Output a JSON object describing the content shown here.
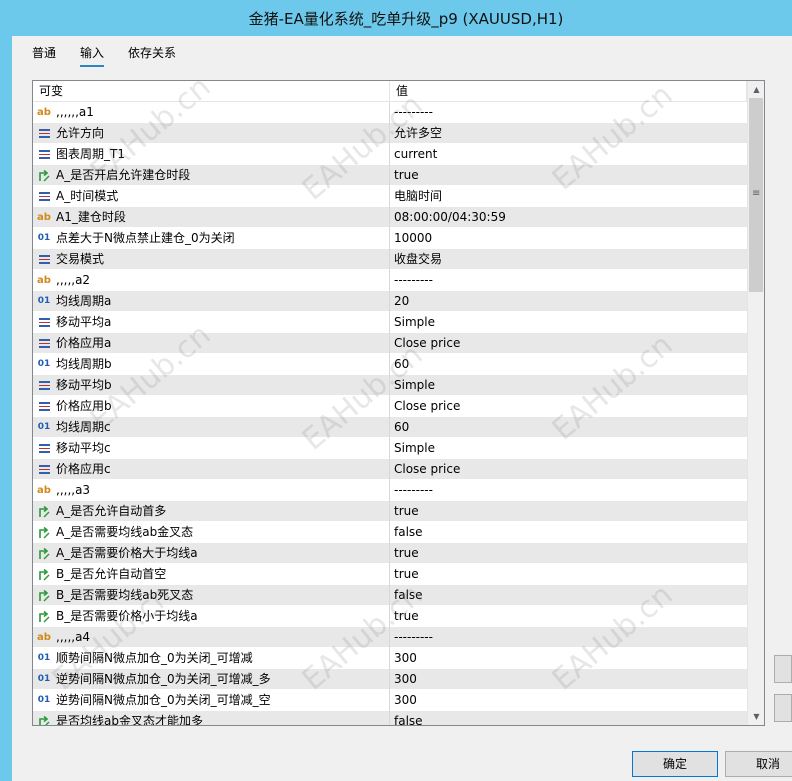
{
  "window": {
    "title": "金猪-EA量化系统_吃单升级_p9   (XAUUSD,H1)"
  },
  "tabs": [
    {
      "label": "普通",
      "active": false
    },
    {
      "label": "输入",
      "active": true
    },
    {
      "label": "依存关系",
      "active": false
    }
  ],
  "grid": {
    "headers": {
      "variable": "可变",
      "value": "值"
    },
    "rows": [
      {
        "icon": "ab",
        "name": ",,,,,,a1",
        "value": "---------"
      },
      {
        "icon": "list",
        "name": "允许方向",
        "value": "允许多空"
      },
      {
        "icon": "list",
        "name": "图表周期_T1",
        "value": "current"
      },
      {
        "icon": "bool",
        "name": "A_是否开启允许建仓时段",
        "value": "true"
      },
      {
        "icon": "list",
        "name": "A_时间模式",
        "value": "电脑时间"
      },
      {
        "icon": "ab",
        "name": "A1_建仓时段",
        "value": "08:00:00/04:30:59"
      },
      {
        "icon": "num",
        "name": "点差大于N微点禁止建仓_0为关闭",
        "value": "10000"
      },
      {
        "icon": "list",
        "name": "交易模式",
        "value": "收盘交易"
      },
      {
        "icon": "ab",
        "name": ",,,,,a2",
        "value": "---------"
      },
      {
        "icon": "num",
        "name": "均线周期a",
        "value": "20"
      },
      {
        "icon": "list",
        "name": "移动平均a",
        "value": "Simple"
      },
      {
        "icon": "list",
        "name": "价格应用a",
        "value": "Close price"
      },
      {
        "icon": "num",
        "name": "均线周期b",
        "value": "60"
      },
      {
        "icon": "list",
        "name": "移动平均b",
        "value": "Simple"
      },
      {
        "icon": "list",
        "name": "价格应用b",
        "value": "Close price"
      },
      {
        "icon": "num",
        "name": "均线周期c",
        "value": "60"
      },
      {
        "icon": "list",
        "name": "移动平均c",
        "value": "Simple"
      },
      {
        "icon": "list",
        "name": "价格应用c",
        "value": "Close price"
      },
      {
        "icon": "ab",
        "name": ",,,,,a3",
        "value": "---------"
      },
      {
        "icon": "bool",
        "name": "A_是否允许自动首多",
        "value": "true"
      },
      {
        "icon": "bool",
        "name": "A_是否需要均线ab金叉态",
        "value": "false"
      },
      {
        "icon": "bool",
        "name": "A_是否需要价格大于均线a",
        "value": "true"
      },
      {
        "icon": "bool",
        "name": "B_是否允许自动首空",
        "value": "true"
      },
      {
        "icon": "bool",
        "name": "B_是否需要均线ab死叉态",
        "value": "false"
      },
      {
        "icon": "bool",
        "name": "B_是否需要价格小于均线a",
        "value": "true"
      },
      {
        "icon": "ab",
        "name": ",,,,,a4",
        "value": "---------"
      },
      {
        "icon": "num",
        "name": "顺势间隔N微点加仓_0为关闭_可增减",
        "value": "300"
      },
      {
        "icon": "num",
        "name": "逆势间隔N微点加仓_0为关闭_可增减_多",
        "value": "300"
      },
      {
        "icon": "num",
        "name": "逆势间隔N微点加仓_0为关闭_可增减_空",
        "value": "300"
      },
      {
        "icon": "bool",
        "name": "是否均线ab金叉态才能加多",
        "value": "false"
      }
    ]
  },
  "icons": {
    "ab": "ab",
    "num": "01"
  },
  "buttons": {
    "ok": "确定",
    "cancel": "取消"
  },
  "watermark": "EAHub.cn",
  "colors": {
    "titlebar": "#6cc9ec",
    "accent": "#0078d7"
  }
}
